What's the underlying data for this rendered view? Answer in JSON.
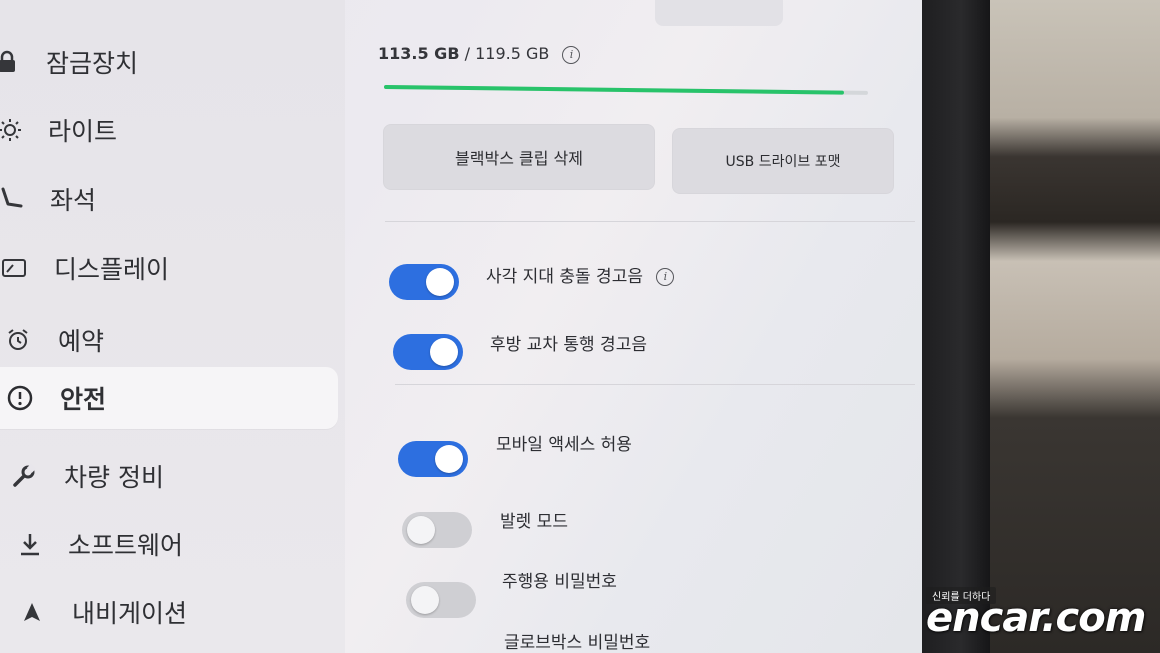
{
  "sidebar": {
    "items": [
      {
        "label": "잠금장치",
        "icon": "lock-icon"
      },
      {
        "label": "라이트",
        "icon": "sun-icon"
      },
      {
        "label": "좌석",
        "icon": "seat-icon"
      },
      {
        "label": "디스플레이",
        "icon": "display-icon"
      },
      {
        "label": "예약",
        "icon": "alarm-clock-icon"
      },
      {
        "label": "안전",
        "icon": "alert-circle-icon",
        "active": true
      },
      {
        "label": "차량 정비",
        "icon": "wrench-icon"
      },
      {
        "label": "소프트웨어",
        "icon": "download-icon"
      },
      {
        "label": "내비게이션",
        "icon": "navigation-arrow-icon"
      }
    ]
  },
  "storage": {
    "used": "113.5 GB",
    "separator": "/",
    "total": "119.5 GB",
    "fill_fraction": 0.95,
    "bar_color": "#28c36a"
  },
  "buttons": {
    "delete_clips": "블랙박스 클립 삭제",
    "format_usb": "USB 드라이브 포맷"
  },
  "toggles": [
    {
      "label": "사각 지대 충돌 경고음",
      "on": true,
      "info": true
    },
    {
      "label": "후방 교차 통행 경고음",
      "on": true
    },
    {
      "label": "모바일 액세스 허용",
      "on": true
    },
    {
      "label": "발렛 모드",
      "on": false
    },
    {
      "label": "주행용 비밀번호",
      "on": false
    },
    {
      "label": "글로브박스 비밀번호",
      "on": false
    }
  ],
  "colors": {
    "toggle_on": "#2d6fe0",
    "toggle_off": "#cfcfd3"
  },
  "watermark": {
    "tagline": "신뢰를 더하다",
    "brand": "encar.com"
  }
}
